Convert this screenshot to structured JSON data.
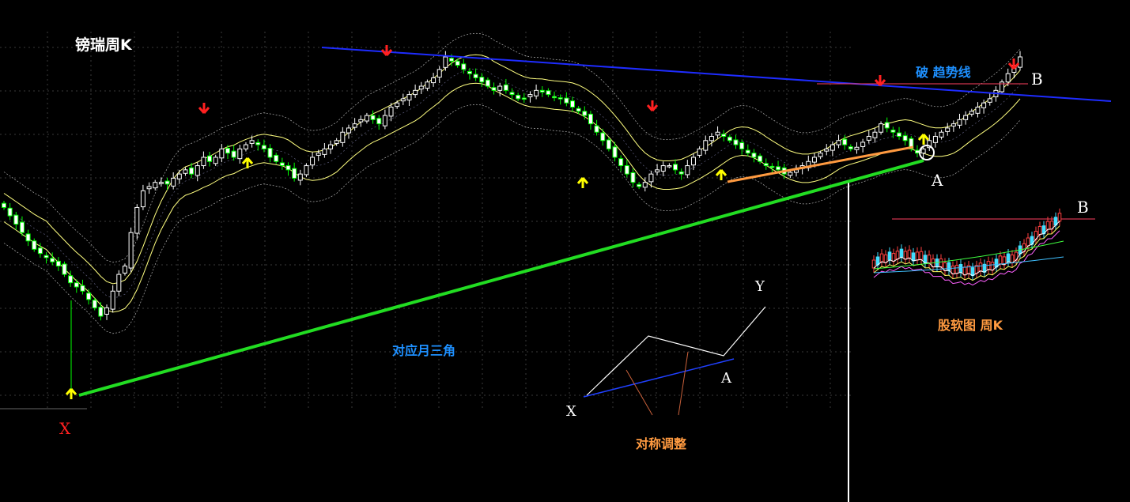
{
  "title": "镑瑞周K",
  "labels": {
    "break_trendline": "破 趋势线",
    "monthly_triangle": "对应月三角",
    "symmetric_adjust": "对称调整",
    "inset_caption": "股软图 周K",
    "point_x": "X",
    "point_a": "A",
    "point_b": "B",
    "point_y": "Y",
    "inset_b": "B",
    "diagram_x": "X",
    "diagram_a": "A",
    "diagram_y": "Y"
  },
  "colors": {
    "background": "#000000",
    "bull_candle": "#ffffff",
    "bear_candle": "#00ff00",
    "ma": "#ffff80",
    "bands": "#b0b0b0",
    "trend_resistance": "#1e2cff",
    "trend_support": "#22dd22",
    "support_short": "#ff9a40",
    "up_arrow": "#ffff00",
    "down_arrow": "#ff2020",
    "label_red": "#ff2020",
    "label_blue": "#1e90ff",
    "label_orange": "#ff9a40"
  },
  "chart_data": {
    "type": "candlestick",
    "title": "镑瑞周K",
    "grid": true,
    "legend": "none",
    "series": [
      {
        "name": "price",
        "closes": [
          2.5,
          2.4,
          2.3,
          2.2,
          2.1,
          2.0,
          1.95,
          1.9,
          1.85,
          1.8,
          1.7,
          1.6,
          1.55,
          1.5,
          1.4,
          1.3,
          1.2,
          1.3,
          1.5,
          1.7,
          1.8,
          2.2,
          2.5,
          2.7,
          2.75,
          2.8,
          2.8,
          2.78,
          2.85,
          2.9,
          2.95,
          2.9,
          3.0,
          3.1,
          3.05,
          3.1,
          3.2,
          3.15,
          3.1,
          3.2,
          3.25,
          3.3,
          3.25,
          3.2,
          3.1,
          3.05,
          3.0,
          2.95,
          2.85,
          2.9,
          3.0,
          3.1,
          3.15,
          3.2,
          3.25,
          3.3,
          3.4,
          3.45,
          3.5,
          3.55,
          3.6,
          3.55,
          3.5,
          3.6,
          3.7,
          3.75,
          3.8,
          3.85,
          3.9,
          3.95,
          4.0,
          4.05,
          4.15,
          4.3,
          4.25,
          4.2,
          4.15,
          4.1,
          4.05,
          4.0,
          3.95,
          3.9,
          3.95,
          3.9,
          3.85,
          3.8,
          3.8,
          3.85,
          3.9,
          3.88,
          3.85,
          3.82,
          3.8,
          3.75,
          3.7,
          3.65,
          3.6,
          3.5,
          3.4,
          3.3,
          3.2,
          3.1,
          3.0,
          2.9,
          2.8,
          2.75,
          2.8,
          2.9,
          2.95,
          3.0,
          3.0,
          2.95,
          2.9,
          3.0,
          3.1,
          3.2,
          3.3,
          3.35,
          3.4,
          3.35,
          3.3,
          3.25,
          3.2,
          3.15,
          3.1,
          3.05,
          3.0,
          2.98,
          2.95,
          2.9,
          2.92,
          2.95,
          3.0,
          3.05,
          3.1,
          3.15,
          3.2,
          3.25,
          3.3,
          3.25,
          3.2,
          3.22,
          3.28,
          3.35,
          3.4,
          3.5,
          3.45,
          3.4,
          3.35,
          3.3,
          3.2,
          3.15,
          3.2,
          3.3,
          3.35,
          3.4,
          3.45,
          3.5,
          3.55,
          3.6,
          3.65,
          3.7,
          3.75,
          3.8,
          3.9,
          4.0,
          4.1,
          4.2,
          4.3
        ]
      }
    ],
    "markers": [
      {
        "label": "X",
        "type": "low"
      },
      {
        "label": "A",
        "type": "low"
      },
      {
        "label": "B",
        "type": "high"
      }
    ]
  }
}
